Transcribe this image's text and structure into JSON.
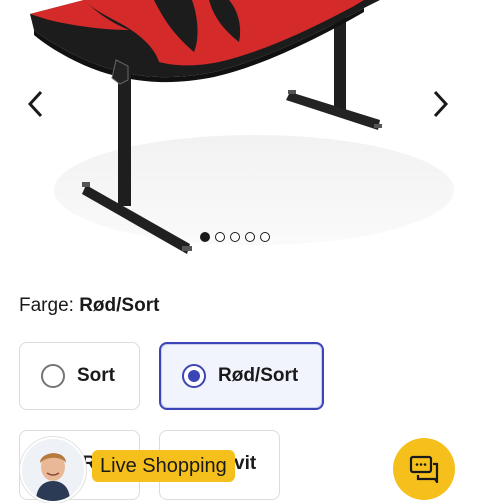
{
  "gallery": {
    "product_alt": "Gaming desk with red and black top",
    "slides_total": 5,
    "active_slide": 1,
    "prev_icon": "chevron-left-icon",
    "next_icon": "chevron-right-icon"
  },
  "color": {
    "label": "Farge:",
    "selected": "Rød/Sort"
  },
  "options": [
    {
      "label": "Sort",
      "selected": false
    },
    {
      "label": "Rød/Sort",
      "selected": true
    },
    {
      "label": "R",
      "selected": false
    },
    {
      "label": "vit",
      "selected": false
    }
  ],
  "live_shopping": {
    "label": "Live Shopping",
    "color": "#f6c01c"
  },
  "chat": {
    "icon": "chat-icon",
    "color": "#f6c01c"
  },
  "colors": {
    "accent": "#3b45b8",
    "brand_yellow": "#f6c01c"
  }
}
